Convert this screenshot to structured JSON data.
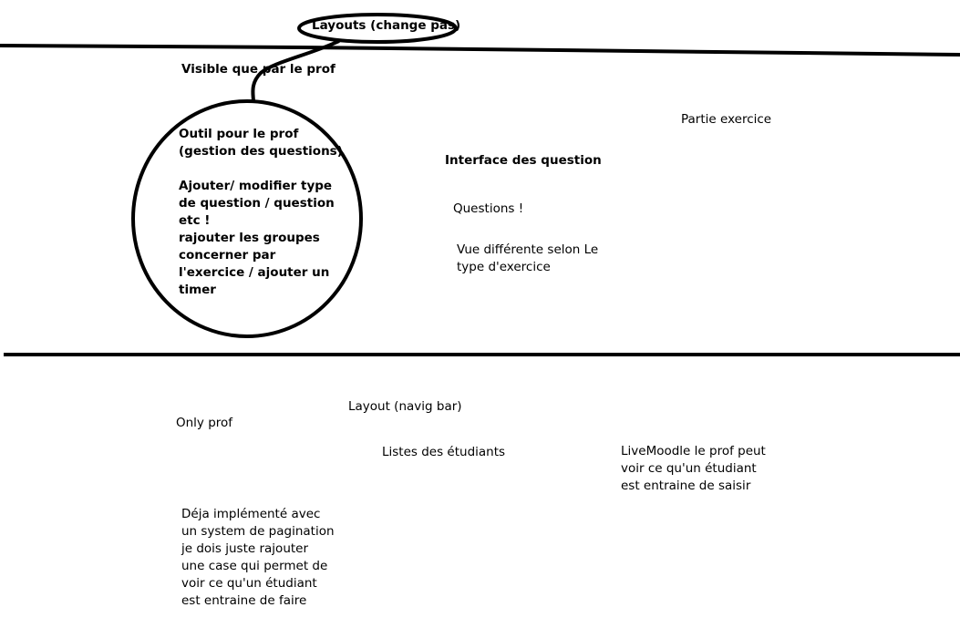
{
  "top_bubble": "Layouts (change pas)",
  "visible_prof": "Visible que par le prof",
  "tool_circle": {
    "lines": [
      "Outil pour le prof",
      "(gestion des questions)",
      "",
      "Ajouter/ modifier type",
      "de question / question",
      "etc !",
      "rajouter les groupes",
      "concerner par",
      "l'exercice / ajouter un",
      "timer"
    ]
  },
  "partie_exercice": "Partie exercice",
  "interface_questions": "Interface des question",
  "questions": "Questions !",
  "vue_differente": {
    "lines": [
      "Vue différente selon Le",
      "type d'exercice"
    ]
  },
  "layout_navbar": "Layout (navig bar)",
  "only_prof": "Only prof",
  "listes_etudiants": "Listes des étudiants",
  "livemoodle": {
    "lines": [
      "LiveMoodle le prof peut",
      "voir ce qu'un étudiant",
      "est entraine de saisir"
    ]
  },
  "deja_implemente": {
    "lines": [
      "Déja implémenté avec",
      "un system de pagination",
      "je dois juste rajouter",
      "une case qui permet de",
      "voir ce qu'un étudiant",
      "est entraine de faire"
    ]
  }
}
